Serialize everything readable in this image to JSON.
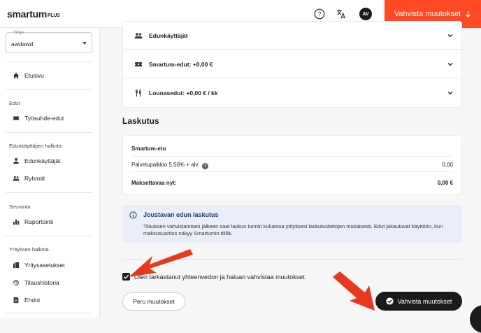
{
  "header": {
    "logo_main": "smartum",
    "logo_suffix": "PLUS",
    "avatar_initials": "AV",
    "cta_label": "Vahvista muutokset"
  },
  "sidebar": {
    "select_label": "Yritys",
    "select_value": "awdawd",
    "home": "Etusivu",
    "sections": [
      {
        "label": "Edut",
        "items": [
          "Työsuhde-edut"
        ]
      },
      {
        "label": "Edunkäyttäjien hallinta",
        "items": [
          "Edunkäyttäjät",
          "Ryhmät"
        ]
      },
      {
        "label": "Seuranta",
        "items": [
          "Raportointi"
        ]
      },
      {
        "label": "Yrityksen hallinta",
        "items": [
          "Yritysasetukset",
          "Tilaushistoria",
          "Ehdot"
        ]
      }
    ]
  },
  "accordion": [
    {
      "label": "Edunkäyttäjät",
      "icon": "users-icon"
    },
    {
      "label": "Smartum-edut: +0,00 €",
      "icon": "ticket-icon"
    },
    {
      "label": "Lounasedut: +0,00 € / kk",
      "icon": "fork-knife-icon"
    }
  ],
  "billing": {
    "title": "Laskutus",
    "section": "Smartum-etu",
    "fee_label": "Palvelupalkkio 5,50% + alv.",
    "fee_value": "0,00",
    "total_label": "Maksettavaa nyt:",
    "total_value": "0,00 €"
  },
  "info": {
    "title": "Joustavan edun laskutus",
    "body": "Tilauksen vahvistamisen jälkeen saat laskun tunnin kuluessa yrityksesi laskutustietojen mukaisesti. Edut jakautuvat käyttöön, kun maksusuoritus näkyy Smartumin tilillä."
  },
  "confirm": {
    "checkbox_text": "Olen tarkastanut yhteenvedon ja haluan vahvistaa muutokset.",
    "cancel_label": "Peru muutokset",
    "submit_label": "Vahvista muutokset"
  },
  "colors": {
    "accent": "#ff4a24",
    "dark": "#1b1b1b",
    "info_bg": "#eaeef8",
    "annotation_arrow": "#e8381e"
  }
}
